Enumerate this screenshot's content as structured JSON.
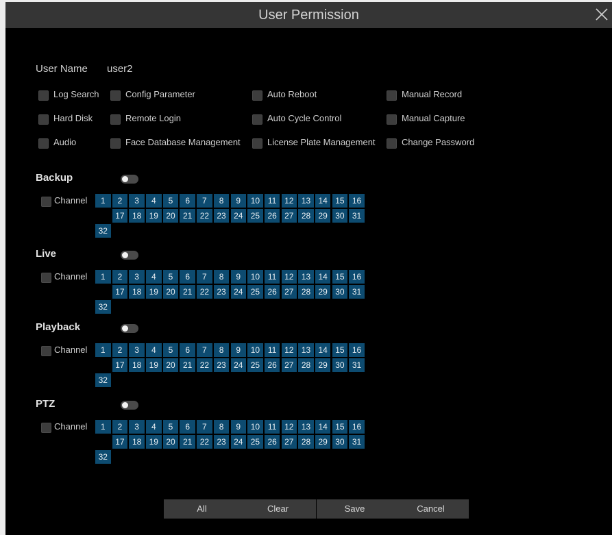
{
  "dialog": {
    "title": "User Permission"
  },
  "user": {
    "label": "User Name",
    "value": "user2"
  },
  "permissions": [
    "Log Search",
    "Config Parameter",
    "Auto Reboot",
    "Manual Record",
    "Hard Disk",
    "Remote Login",
    "Auto Cycle Control",
    "Manual Capture",
    "Audio",
    "Face Database Management",
    "License Plate Management",
    "Change Password"
  ],
  "sections": [
    {
      "title": "Backup",
      "channel_label": "Channel"
    },
    {
      "title": "Live",
      "channel_label": "Channel"
    },
    {
      "title": "Playback",
      "channel_label": "Channel"
    },
    {
      "title": "PTZ",
      "channel_label": "Channel"
    }
  ],
  "channels": [
    "1",
    "2",
    "3",
    "4",
    "5",
    "6",
    "7",
    "8",
    "9",
    "10",
    "11",
    "12",
    "13",
    "14",
    "15",
    "16",
    "17",
    "18",
    "19",
    "20",
    "21",
    "22",
    "23",
    "24",
    "25",
    "26",
    "27",
    "28",
    "29",
    "30",
    "31",
    "32"
  ],
  "buttons": {
    "all": "All",
    "clear": "Clear",
    "save": "Save",
    "cancel": "Cancel"
  },
  "colors": {
    "channel_cell": "#0d4b70",
    "dialog_bg": "#000000",
    "titlebar": "#353535"
  }
}
